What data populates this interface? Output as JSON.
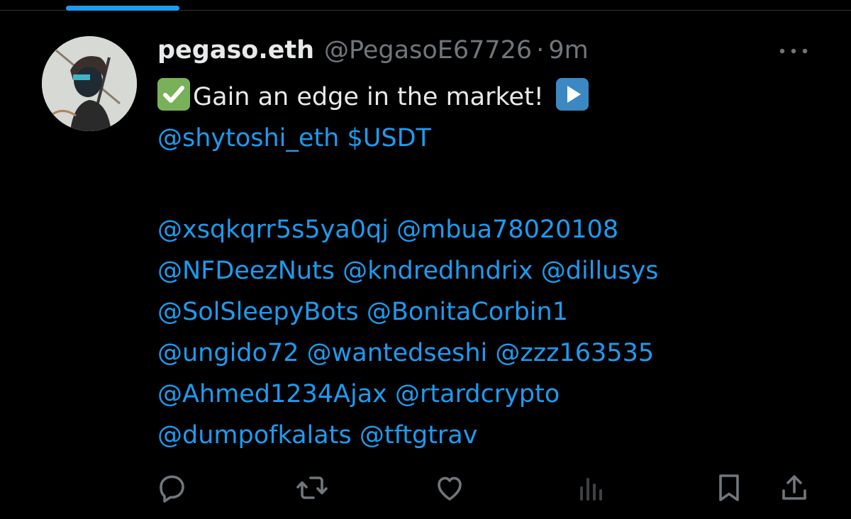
{
  "tweet": {
    "author": {
      "display_name": "pegaso.eth",
      "handle": "@PegasoE67726",
      "separator": "·",
      "time": "9m"
    },
    "line1": {
      "check_emoji": "check-mark-button-emoji",
      "text": "Gain an edge in the market!",
      "play_emoji": "play-button-emoji"
    },
    "line2": [
      "@shytoshi_eth",
      "$USDT"
    ],
    "mention_lines": [
      [
        "@xsqkqrr5s5ya0qj",
        "@mbua78020108"
      ],
      [
        "@NFDeezNuts",
        "@kndredhndrix",
        "@dillusys"
      ],
      [
        "@SolSleepyBots",
        "@BonitaCorbin1"
      ],
      [
        "@ungido72",
        "@wantedseshi",
        "@zzz163535"
      ],
      [
        "@Ahmed1234Ajax",
        "@rtardcrypto"
      ],
      [
        "@dumpofkalats",
        "@tftgtrav"
      ]
    ]
  },
  "actions": {
    "icons": [
      "reply-icon",
      "retweet-icon",
      "like-icon",
      "views-icon",
      "bookmark-icon",
      "share-icon"
    ]
  },
  "colors": {
    "background": "#000000",
    "text": "#e7e9ea",
    "muted": "#71767b",
    "link": "#1d9bf0"
  }
}
